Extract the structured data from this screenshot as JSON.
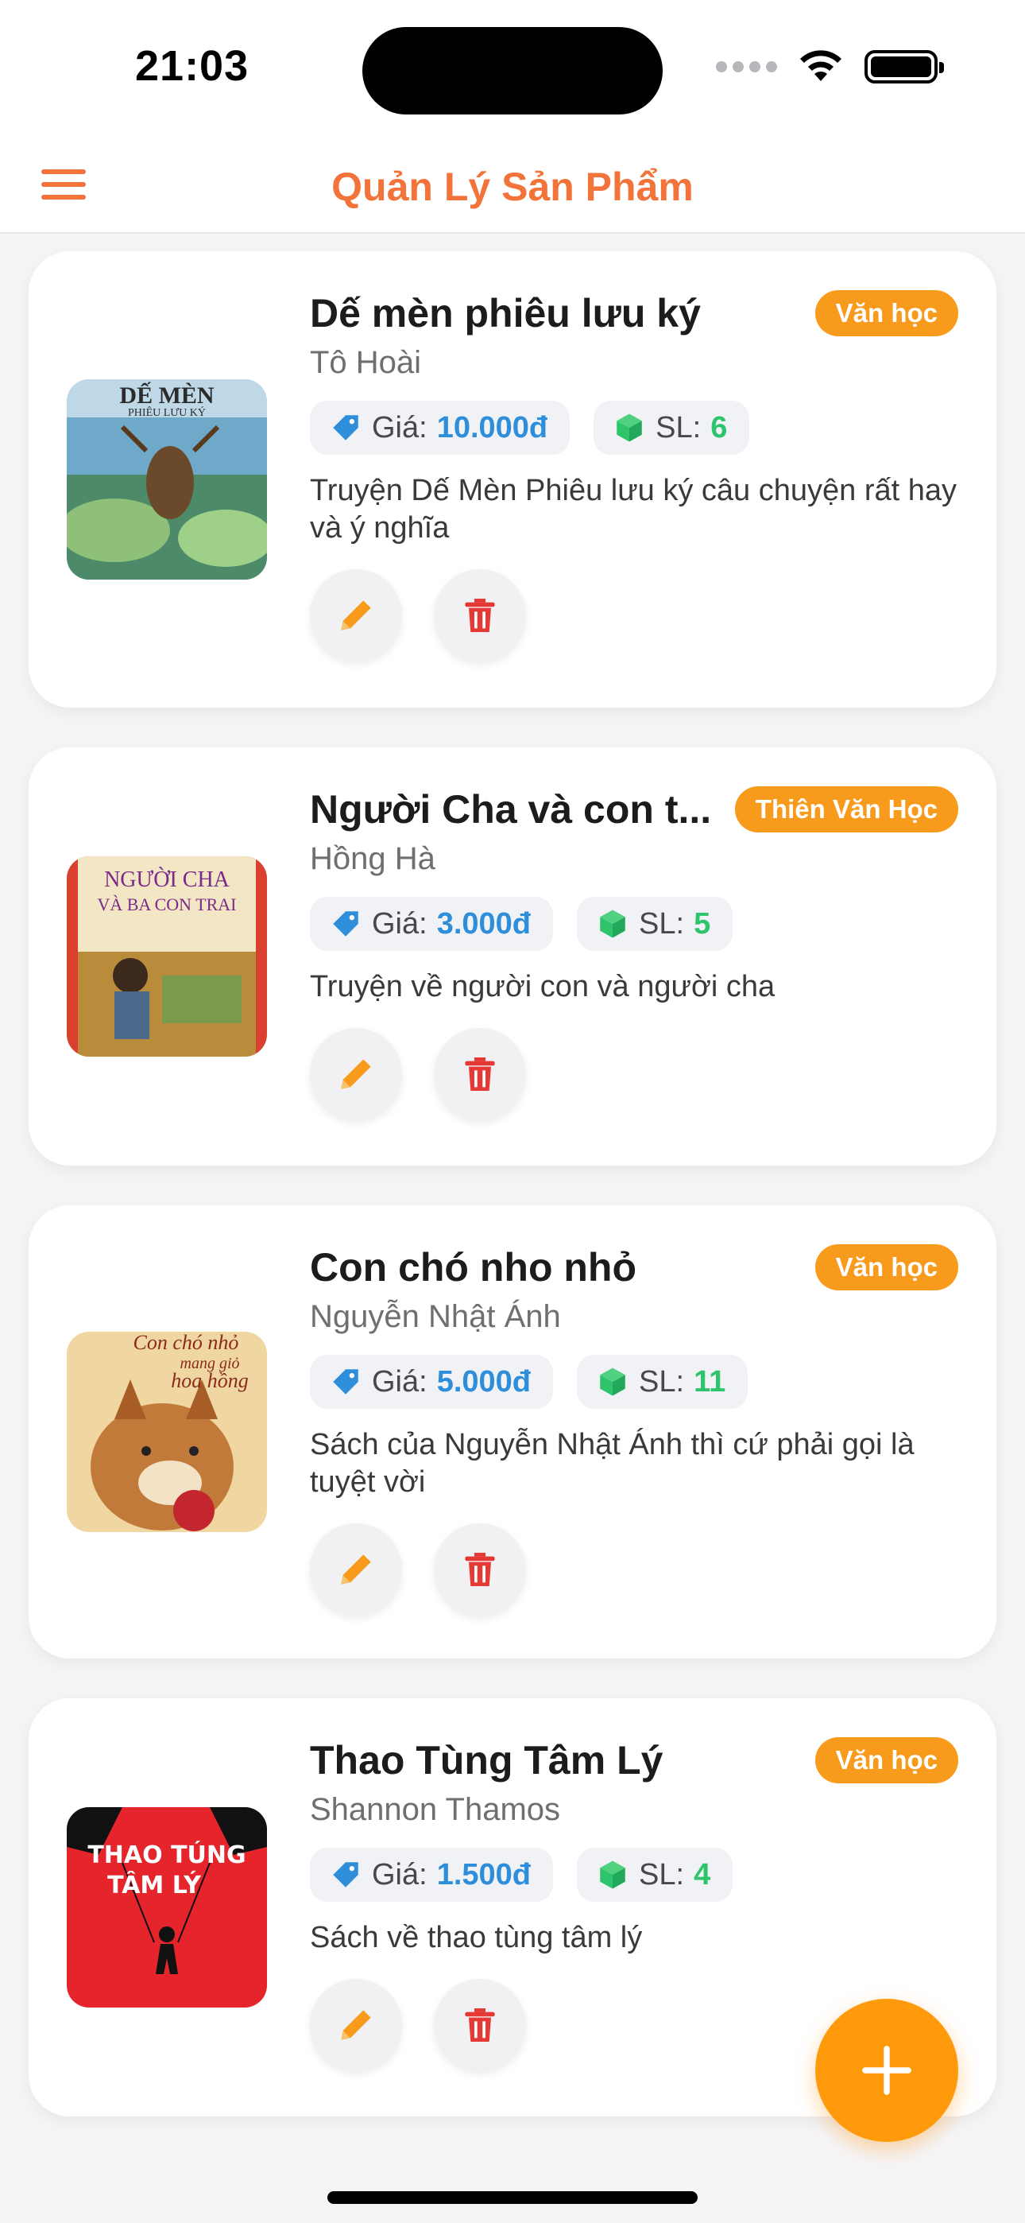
{
  "status_bar": {
    "time": "21:03"
  },
  "header": {
    "title": "Quản Lý Sản Phẩm",
    "menu_icon": "hamburger-menu-icon"
  },
  "labels": {
    "price_label": "Giá:",
    "qty_label": "SL:"
  },
  "colors": {
    "accent": "#f2743a",
    "badge": "#f89a1c",
    "price": "#2f8ed9",
    "quantity": "#2ec46b",
    "edit": "#f89a1c",
    "delete": "#e53935",
    "fab": "#ff9a0c"
  },
  "products": [
    {
      "title": "Dế mèn phiêu lưu ký",
      "author": "Tô Hoài",
      "category": "Văn học",
      "price": "10.000đ",
      "quantity": "6",
      "description": "Truyện Dế Mèn Phiêu lưu ký câu chuyện rất hay và ý nghĩa",
      "cover_text": [
        "DẾ MÈN",
        "PHIÊU LƯU KÝ"
      ]
    },
    {
      "title": "Người Cha và con t...",
      "author": "Hồng Hà",
      "category": "Thiên Văn Học",
      "price": "3.000đ",
      "quantity": "5",
      "description": "Truyện về người con và người cha",
      "cover_text": [
        "NGƯỜI CHA",
        "VÀ BA CON TRAI"
      ]
    },
    {
      "title": "Con chó nho nhỏ",
      "author": "Nguyễn Nhật Ánh",
      "category": "Văn học",
      "price": "5.000đ",
      "quantity": "11",
      "description": "Sách của Nguyễn Nhật Ánh thì cứ phải gọi là tuyệt vời",
      "cover_text": [
        "Con chó nhỏ",
        "mang giỏ",
        "hoa hồng"
      ]
    },
    {
      "title": "Thao Tùng Tâm Lý",
      "author": "Shannon Thamos",
      "category": "Văn học",
      "price": "1.500đ",
      "quantity": "4",
      "description": "Sách về thao tùng tâm lý",
      "cover_text": [
        "THAO TÚNG",
        "TÂM LÝ"
      ]
    }
  ],
  "fab": {
    "icon": "plus-icon"
  }
}
